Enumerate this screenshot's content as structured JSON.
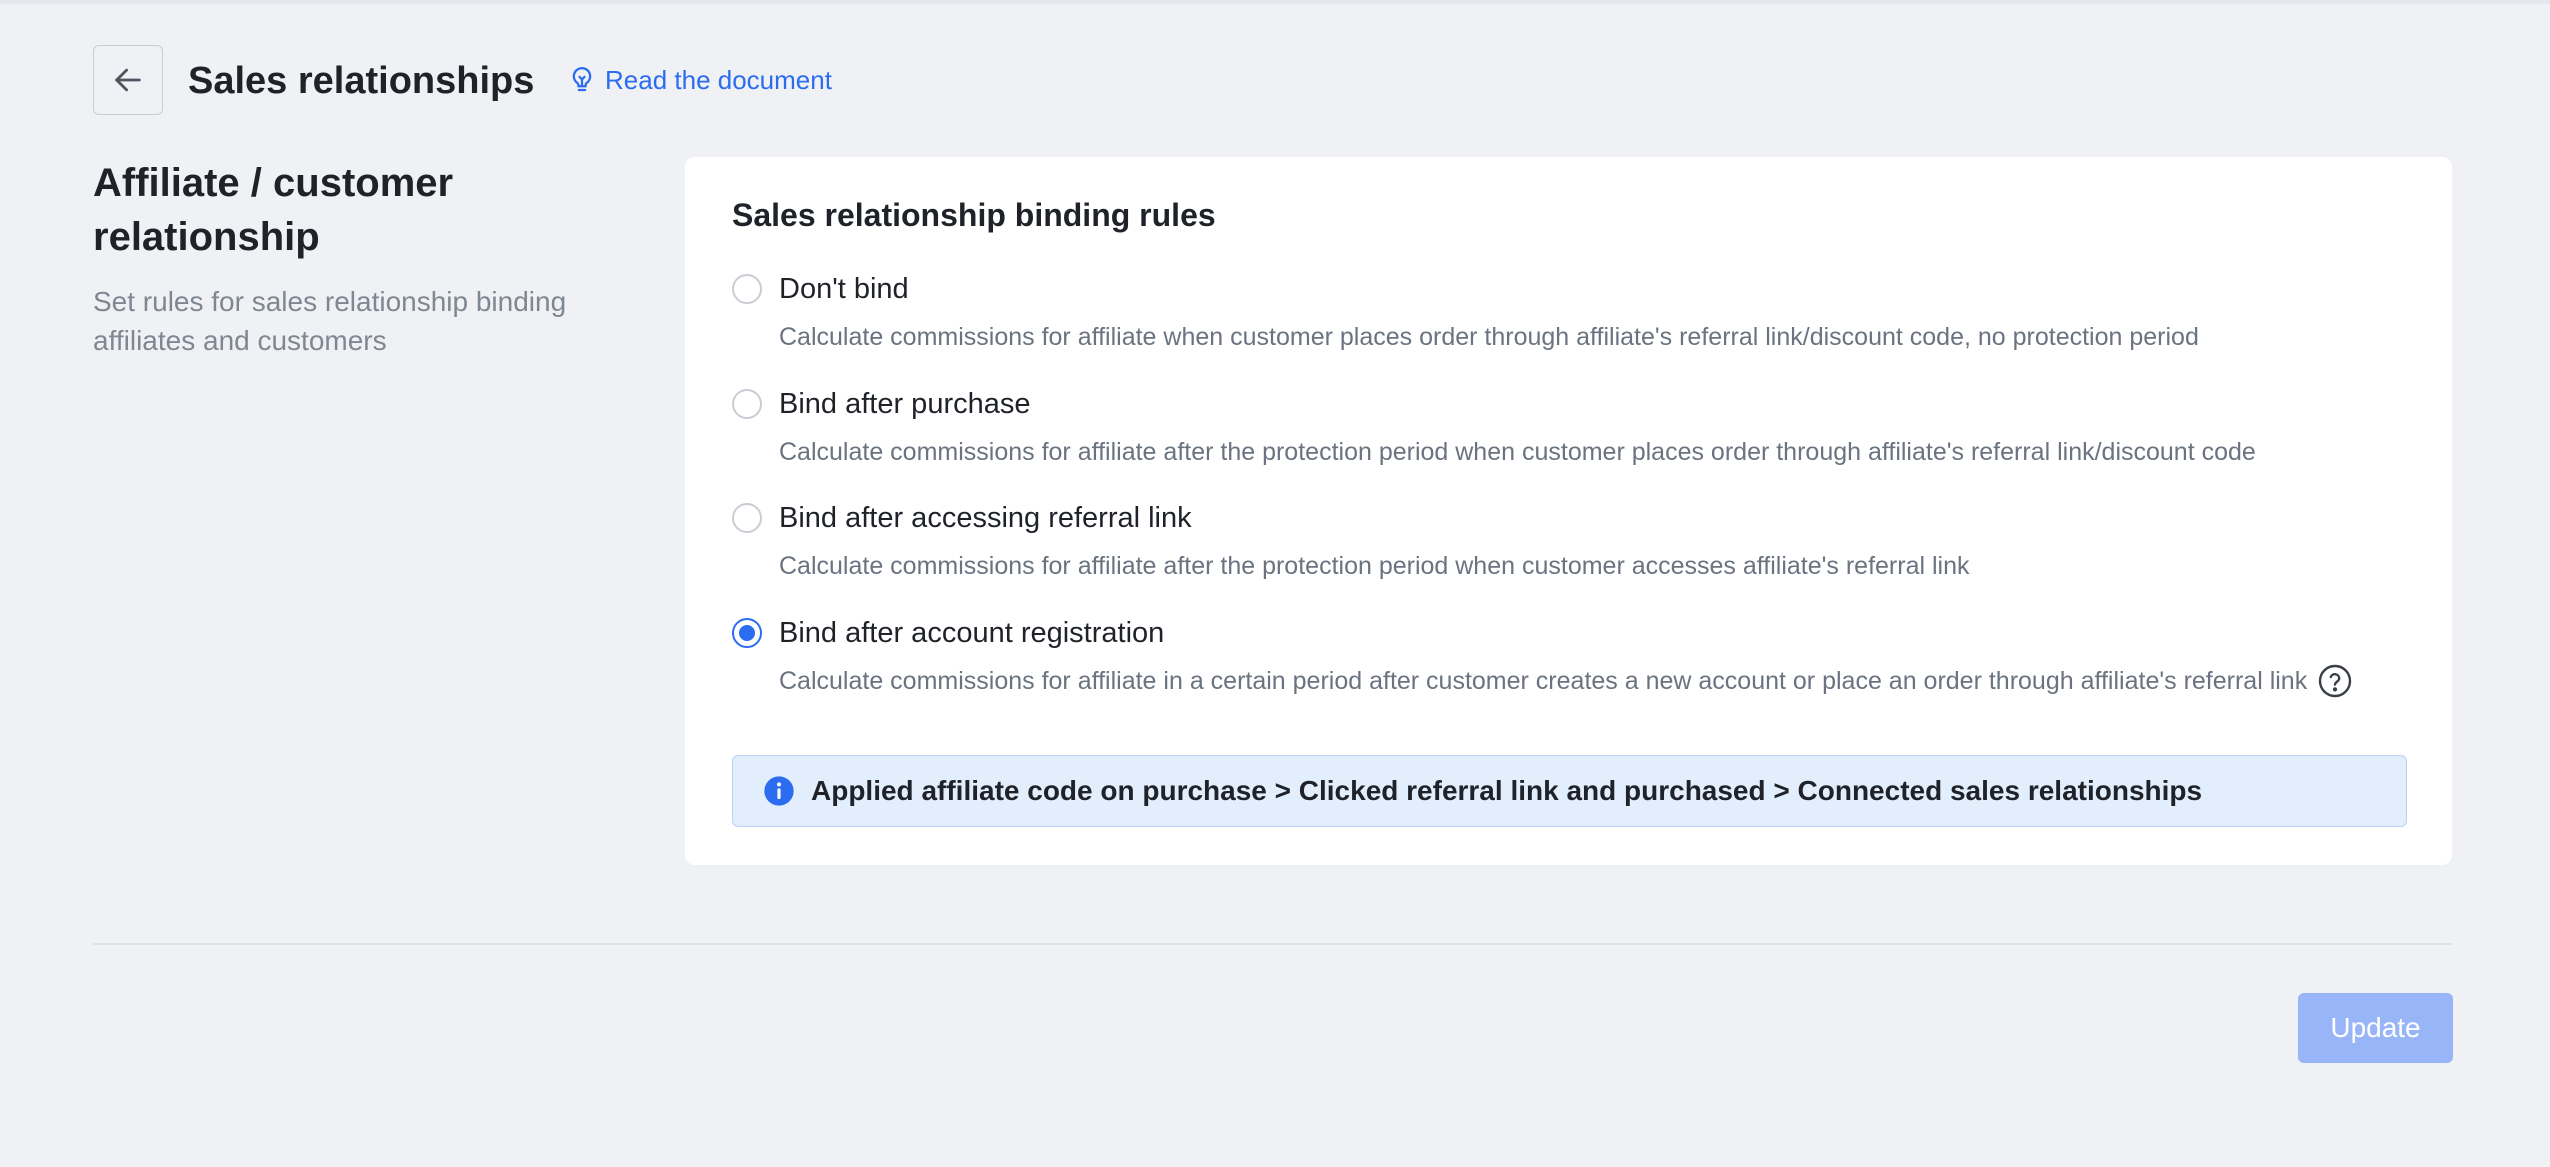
{
  "header": {
    "title": "Sales relationships",
    "doc_link": "Read the document"
  },
  "section": {
    "title": "Affiliate / customer relationship",
    "description": "Set rules for sales relationship binding affiliates and customers"
  },
  "card": {
    "title": "Sales relationship binding rules",
    "selected": "Bind after account registration",
    "options": [
      {
        "label": "Don't bind",
        "description": "Calculate commissions for affiliate when customer places order through affiliate's referral link/discount code, no protection period",
        "checked": false
      },
      {
        "label": "Bind after purchase",
        "description": "Calculate commissions for affiliate after the protection period when customer places order through affiliate's referral link/discount code",
        "checked": false
      },
      {
        "label": "Bind after accessing referral link",
        "description": "Calculate commissions for affiliate after the protection period when customer accesses affiliate's referral link",
        "checked": false
      },
      {
        "label": "Bind after account registration",
        "description": "Calculate commissions for affiliate in a certain period after customer creates a new account or place an order through affiliate's referral link",
        "checked": true
      }
    ],
    "info": "Applied affiliate code on purchase > Clicked referral link and purchased > Connected sales relationships"
  },
  "footer": {
    "update_label": "Update"
  },
  "colors": {
    "accent": "#2b6cf0",
    "info_bg": "#e3eefc",
    "update_disabled": "#98b5f8",
    "page_bg": "#f0f1f5"
  },
  "icons": {
    "back": "arrow-left-icon",
    "doc": "lightbulb-icon",
    "help": "question-circle-icon",
    "info": "info-icon"
  }
}
